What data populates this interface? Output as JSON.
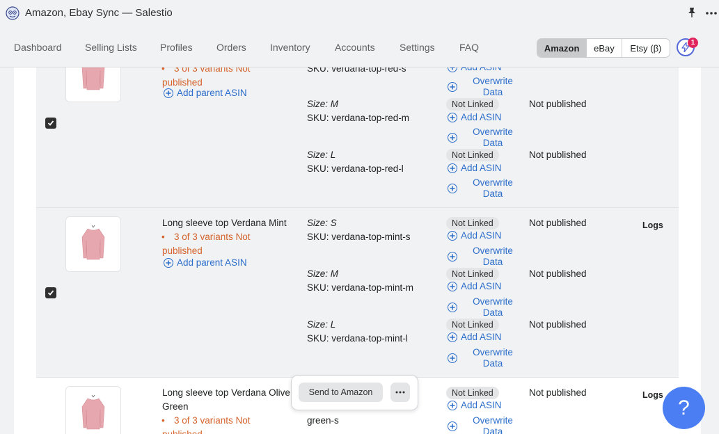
{
  "app": {
    "title": "Amazon, Ebay Sync — Salestio"
  },
  "nav": {
    "items": [
      "Dashboard",
      "Selling Lists",
      "Profiles",
      "Orders",
      "Inventory",
      "Accounts",
      "Settings",
      "FAQ"
    ],
    "marketplaces": [
      "Amazon",
      "eBay",
      "Etsy (β)"
    ],
    "active_marketplace": "Amazon",
    "notification_count": "1"
  },
  "labels": {
    "add_parent_asin": "Add parent ASIN",
    "add_asin": "Add ASIN",
    "overwrite_1": "Overwrite",
    "overwrite_2": "Data",
    "not_linked": "Not Linked",
    "not_published": "Not published",
    "logs": "Logs",
    "variants_line1": "3 of 3 variants Not",
    "variants_line2": "published",
    "bullet": "•"
  },
  "products": [
    {
      "title": "",
      "variants": [
        {
          "size": "",
          "sku": "SKU: verdana-top-red-s"
        },
        {
          "size": "Size: M",
          "sku": "SKU: verdana-top-red-m"
        },
        {
          "size": "Size: L",
          "sku": "SKU: verdana-top-red-l"
        }
      ]
    },
    {
      "title": "Long sleeve top Verdana Mint",
      "variants": [
        {
          "size": "Size: S",
          "sku": "SKU: verdana-top-mint-s"
        },
        {
          "size": "Size: M",
          "sku": "SKU: verdana-top-mint-m"
        },
        {
          "size": "Size: L",
          "sku": "SKU: verdana-top-mint-l"
        }
      ]
    },
    {
      "title_line1": "Long sleeve top Verdana Olive",
      "title_line2": "Green",
      "variants": [
        {
          "size": "",
          "sku": "green-s"
        }
      ]
    }
  ],
  "actions": {
    "send": "Send to Amazon",
    "help": "?"
  },
  "colors": {
    "accent": "#2c6ecb",
    "warning": "#d4622a",
    "help_button": "#4a7ef2",
    "badge": "#e0245e"
  }
}
